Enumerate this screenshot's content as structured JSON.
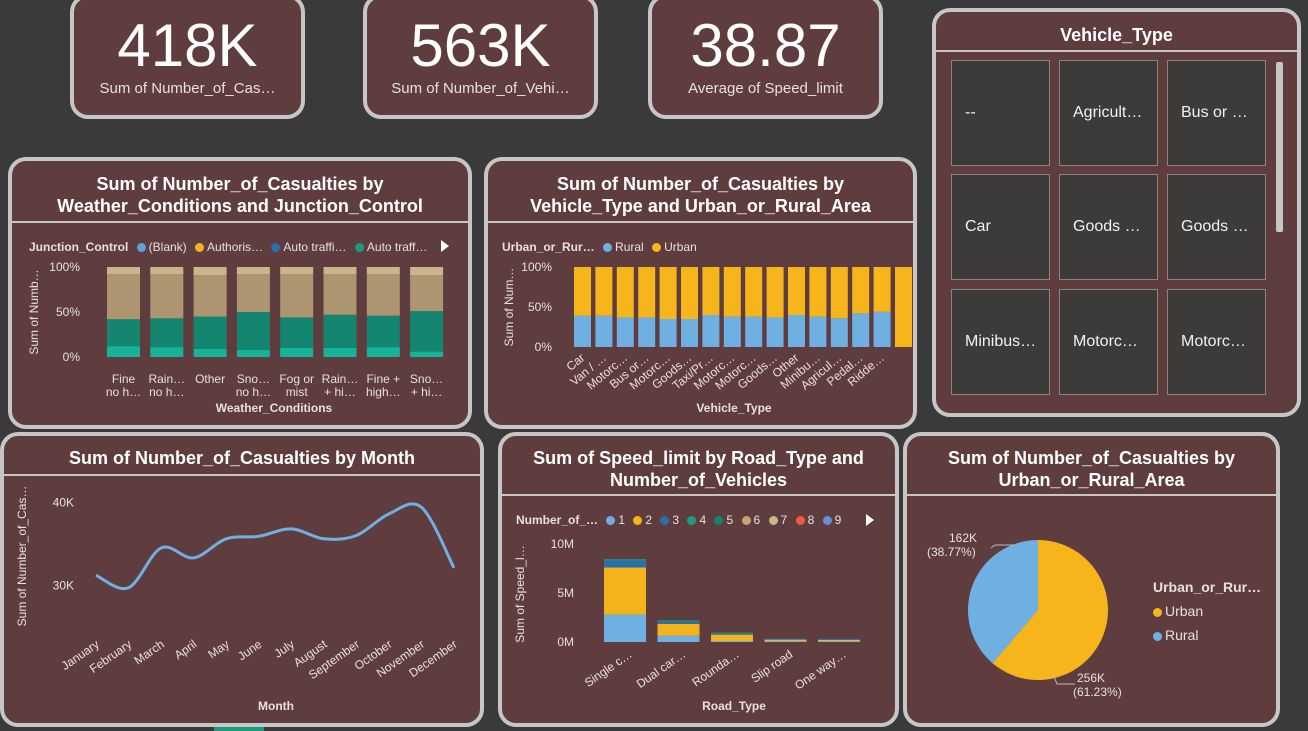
{
  "kpis": [
    {
      "value": "418K",
      "label": "Sum of Number_of_Cas…"
    },
    {
      "value": "563K",
      "label": "Sum of Number_of_Vehi…"
    },
    {
      "value": "38.87",
      "label": "Average of Speed_limit"
    }
  ],
  "slicer": {
    "title": "Vehicle_Type",
    "items": [
      "--",
      "Agricult…",
      "Bus or …",
      "Car",
      "Goods …",
      "Goods …",
      "Minibus…",
      "Motorc…",
      "Motorc…"
    ]
  },
  "colors": {
    "blank": "#5ba3dc",
    "authorised": "#f4b21b",
    "auto_traffic": "#2a6fad",
    "auto_traffic2": "#1f9a7e",
    "rural": "#6fb0e3",
    "urban": "#f7b51c"
  },
  "chart_weather": {
    "title": "Sum of Number_of_Casualties by Weather_Conditions and Junction_Control",
    "legend_title": "Junction_Control",
    "legend": [
      "(Blank)",
      "Authoris…",
      "Auto traffi…",
      "Auto traff…"
    ],
    "chart_data": {
      "type": "bar",
      "stacked": "100%",
      "categories": [
        [
          "Fine",
          "no h…"
        ],
        [
          "Rain…",
          "no h…"
        ],
        [
          "Other"
        ],
        [
          "Sno…",
          "no h…"
        ],
        [
          "Fog or",
          "mist"
        ],
        [
          "Rain…",
          "+ hi…"
        ],
        [
          "Fine +",
          "high…"
        ],
        [
          "Sno…",
          "+ hi…"
        ]
      ],
      "xlabel": "Weather_Conditions",
      "ylabel": "Sum of Numb…",
      "yticks": [
        "100%",
        "50%",
        "0%"
      ],
      "series": [
        {
          "color": "#16b39a",
          "values": [
            0.12,
            0.11,
            0.09,
            0.08,
            0.1,
            0.1,
            0.11,
            0.06
          ]
        },
        {
          "color": "#14856f",
          "values": [
            0.3,
            0.32,
            0.36,
            0.42,
            0.34,
            0.37,
            0.35,
            0.45
          ]
        },
        {
          "color": "#ae9571",
          "values": [
            0.5,
            0.49,
            0.46,
            0.42,
            0.48,
            0.45,
            0.46,
            0.4
          ]
        },
        {
          "color": "#c8b78a",
          "values": [
            0.08,
            0.08,
            0.09,
            0.08,
            0.08,
            0.08,
            0.08,
            0.09
          ]
        }
      ]
    }
  },
  "chart_vehicle": {
    "title": "Sum of Number_of_Casualties by Vehicle_Type and Urban_or_Rural_Area",
    "legend_title": "Urban_or_Rur…",
    "legend": [
      "Rural",
      "Urban"
    ],
    "chart_data": {
      "type": "bar",
      "stacked": "100%",
      "categories": [
        "Car",
        "Van / …",
        "Motorc…",
        "Bus or…",
        "Motorc…",
        "Goods…",
        "Taxi/Pr…",
        "Motorc…",
        "Motorc…",
        "Goods…",
        "Other",
        "Minibu…",
        "Agricul…",
        "Pedal…",
        "Ridde…"
      ],
      "xlabel": "Vehicle_Type",
      "ylabel": "Sum of Num…",
      "yticks": [
        "100%",
        "50%",
        "0%"
      ],
      "series": [
        {
          "name": "Rural",
          "values": [
            0.39,
            0.39,
            0.37,
            0.37,
            0.35,
            0.35,
            0.4,
            0.38,
            0.38,
            0.37,
            0.4,
            0.38,
            0.36,
            0.42,
            0.44,
            0.0
          ]
        },
        {
          "name": "Urban",
          "values": [
            0.61,
            0.61,
            0.63,
            0.63,
            0.65,
            0.65,
            0.6,
            0.62,
            0.62,
            0.63,
            0.6,
            0.62,
            0.64,
            0.58,
            0.56,
            1.0
          ]
        }
      ]
    }
  },
  "chart_month": {
    "title": "Sum of Number_of_Casualties by Month",
    "chart_data": {
      "type": "line",
      "categories": [
        "January",
        "February",
        "March",
        "April",
        "May",
        "June",
        "July",
        "August",
        "September",
        "October",
        "November",
        "December"
      ],
      "values": [
        31200,
        29700,
        34500,
        33300,
        35600,
        35900,
        36800,
        35600,
        36000,
        38600,
        39400,
        32100
      ],
      "ylim": [
        27500,
        41000
      ],
      "yticks": [
        "40K",
        "30K"
      ],
      "xlabel": "Month",
      "ylabel": "Sum of Number_of_Cas…"
    }
  },
  "chart_speed": {
    "title": "Sum of Speed_limit by Road_Type and Number_of_Vehicles",
    "legend_title": "Number_of_…",
    "legend": [
      {
        "label": "1",
        "color": "#6fb0e3"
      },
      {
        "label": "2",
        "color": "#f4b21b"
      },
      {
        "label": "3",
        "color": "#2a6fad"
      },
      {
        "label": "4",
        "color": "#1f9a7e"
      },
      {
        "label": "5",
        "color": "#14856f"
      },
      {
        "label": "6",
        "color": "#c8a07a"
      },
      {
        "label": "7",
        "color": "#c8b78a"
      },
      {
        "label": "8",
        "color": "#ef5a3c"
      },
      {
        "label": "9",
        "color": "#6b8fd4"
      }
    ],
    "chart_data": {
      "type": "bar",
      "stacked": true,
      "categories": [
        "Single c…",
        "Dual car…",
        "Rounda…",
        "Slip road",
        "One way…"
      ],
      "ylim": [
        0,
        10000000
      ],
      "yticks": [
        "10M",
        "5M",
        "0M"
      ],
      "xlabel": "Road_Type",
      "ylabel": "Sum of Speed_l…",
      "series": [
        {
          "name": "1",
          "values": [
            2800000,
            650000,
            80000,
            20000,
            20000
          ]
        },
        {
          "name": "2",
          "values": [
            4800000,
            1200000,
            650000,
            140000,
            120000
          ]
        },
        {
          "name": "3",
          "values": [
            700000,
            250000,
            50000,
            10000,
            10000
          ]
        },
        {
          "name": "4",
          "values": [
            150000,
            100000,
            10000,
            0,
            0
          ]
        }
      ]
    }
  },
  "chart_pie": {
    "title": "Sum of Number_of_Casualties by Urban_or_Rural_Area",
    "legend_title": "Urban_or_Rur…",
    "legend": [
      "Urban",
      "Rural"
    ],
    "chart_data": {
      "type": "pie",
      "slices": [
        {
          "name": "Urban",
          "value": 256000,
          "pct": 61.23,
          "label": "256K",
          "pct_label": "(61.23%)"
        },
        {
          "name": "Rural",
          "value": 162000,
          "pct": 38.77,
          "label": "162K",
          "pct_label": "(38.77%)"
        }
      ]
    }
  }
}
